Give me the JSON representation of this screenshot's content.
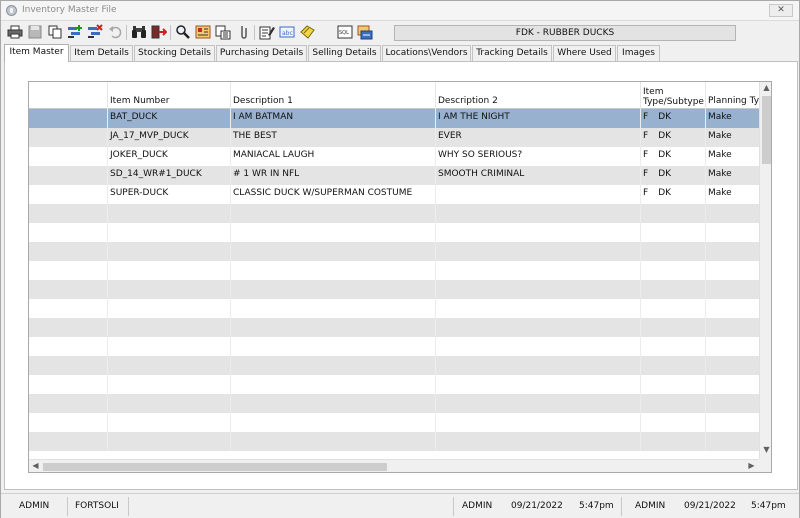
{
  "window": {
    "title": "Inventory Master File",
    "close_glyph": "✕"
  },
  "toolbar": {
    "icons": [
      "print-icon",
      "save-icon",
      "copy-icon",
      "add-record-icon",
      "delete-record-icon",
      "undo-icon",
      "binoculars-icon",
      "exit-icon",
      "search-icon",
      "report-icon",
      "report-list-icon",
      "attachment-icon",
      "edit-icon",
      "abc-label-icon",
      "note-icon",
      "sql-icon",
      "export-icon"
    ],
    "context_label": "FDK - RUBBER DUCKS"
  },
  "tabs": [
    {
      "label": "Item Master",
      "active": true
    },
    {
      "label": "Item Details",
      "active": false
    },
    {
      "label": "Stocking Details",
      "active": false
    },
    {
      "label": "Purchasing Details",
      "active": false
    },
    {
      "label": "Selling Details",
      "active": false
    },
    {
      "label": "Locations\\Vendors",
      "active": false
    },
    {
      "label": "Tracking Details",
      "active": false
    },
    {
      "label": "Where Used",
      "active": false
    },
    {
      "label": "Images",
      "active": false
    }
  ],
  "grid": {
    "columns": [
      "",
      "Item Number",
      "Description 1",
      "Description 2",
      "Item Type/Subtype",
      "Planning Ty"
    ],
    "rows": [
      {
        "item_number": "BAT_DUCK",
        "desc1": "I AM BATMAN",
        "desc2": "I AM THE NIGHT",
        "type": "F",
        "subtype": "DK",
        "planning": "Make",
        "selected": true
      },
      {
        "item_number": "JA_17_MVP_DUCK",
        "desc1": "THE BEST",
        "desc2": "EVER",
        "type": "F",
        "subtype": "DK",
        "planning": "Make",
        "selected": false
      },
      {
        "item_number": "JOKER_DUCK",
        "desc1": "MANIACAL LAUGH",
        "desc2": "WHY SO SERIOUS?",
        "type": "F",
        "subtype": "DK",
        "planning": "Make",
        "selected": false
      },
      {
        "item_number": "SD_14_WR#1_DUCK",
        "desc1": "# 1 WR IN NFL",
        "desc2": "SMOOTH CRIMINAL",
        "type": "F",
        "subtype": "DK",
        "planning": "Make",
        "selected": false
      },
      {
        "item_number": "SUPER-DUCK",
        "desc1": "CLASSIC DUCK W/SUPERMAN COSTUME",
        "desc2": "",
        "type": "F",
        "subtype": "DK",
        "planning": "Make",
        "selected": false
      }
    ],
    "empty_row_count": 13
  },
  "statusbar": {
    "user": "ADMIN",
    "company": "FORTSOLI",
    "created_by": "ADMIN",
    "created_date": "09/21/2022",
    "created_time": "5:47pm",
    "modified_by": "ADMIN",
    "modified_date": "09/21/2022",
    "modified_time": "5:47pm"
  }
}
